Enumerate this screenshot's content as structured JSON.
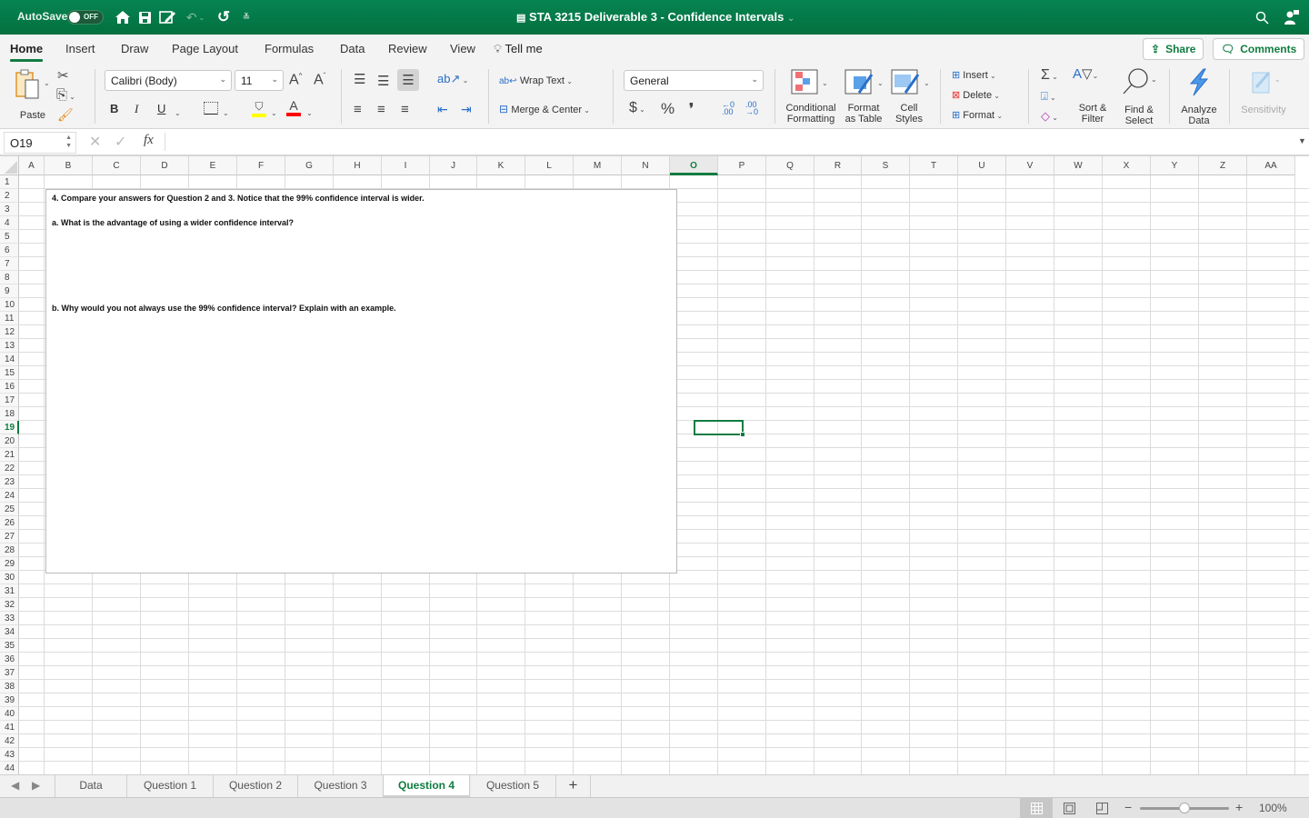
{
  "titlebar": {
    "autosave_label": "AutoSave",
    "autosave_state": "OFF",
    "doc_title": "STA 3215 Deliverable 3 - Confidence Intervals",
    "icons": [
      "home-icon",
      "save-icon",
      "edit-icon",
      "undo-icon",
      "redo-icon",
      "customize-icon",
      "search-icon",
      "account-icon"
    ]
  },
  "ribbon_tabs": [
    "Home",
    "Insert",
    "Draw",
    "Page Layout",
    "Formulas",
    "Data",
    "Review",
    "View"
  ],
  "active_tab": "Home",
  "tell_me": "Tell me",
  "share_label": "Share",
  "comments_label": "Comments",
  "ribbon": {
    "paste": "Paste",
    "font_name": "Calibri (Body)",
    "font_size": "11",
    "bold": "B",
    "italic": "I",
    "underline": "U",
    "wrap_text": "Wrap Text",
    "merge_center": "Merge & Center",
    "number_format": "General",
    "currency": "$",
    "percent": "%",
    "comma": "❜",
    "conditional_formatting": [
      "Conditional",
      "Formatting"
    ],
    "format_as_table": [
      "Format",
      "as Table"
    ],
    "cell_styles": [
      "Cell",
      "Styles"
    ],
    "insert": "Insert",
    "delete": "Delete",
    "format": "Format",
    "sort_filter": [
      "Sort &",
      "Filter"
    ],
    "find_select": [
      "Find &",
      "Select"
    ],
    "analyze_data": [
      "Analyze",
      "Data"
    ],
    "sensitivity": "Sensitivity",
    "colors": {
      "highlight": "#ffff00",
      "font_color": "#ff0000",
      "accent": "#107c41"
    }
  },
  "formula_bar": {
    "name_box": "O19",
    "fx": "fx",
    "formula": ""
  },
  "grid": {
    "columns": [
      "A",
      "B",
      "C",
      "D",
      "E",
      "F",
      "G",
      "H",
      "I",
      "J",
      "K",
      "L",
      "M",
      "N",
      "O",
      "P",
      "Q",
      "R",
      "S",
      "T",
      "U",
      "V",
      "W",
      "X",
      "Y",
      "Z",
      "AA"
    ],
    "selected_column": "O",
    "rows": [
      "1",
      "2",
      "3",
      "4",
      "5",
      "6",
      "7",
      "8",
      "9",
      "10",
      "11",
      "12",
      "13",
      "14",
      "15",
      "16",
      "17",
      "18",
      "19",
      "20",
      "21",
      "22",
      "23",
      "24",
      "25",
      "26",
      "27",
      "28",
      "29",
      "30",
      "31",
      "32",
      "33",
      "34",
      "35",
      "36",
      "37",
      "38",
      "39",
      "40",
      "41",
      "42",
      "43",
      "44"
    ],
    "selected_row": "19",
    "selected_cell": "O19"
  },
  "textbox": {
    "line1": "4. Compare your answers for Question 2 and 3.  Notice that the 99% confidence interval is wider.",
    "line2": "a. What is the advantage of using a wider confidence interval?",
    "line3": "b. Why would you not always use the 99% confidence interval? Explain with an example."
  },
  "sheet_tabs": [
    "Data",
    "Question 1",
    "Question 2",
    "Question 3",
    "Question 4",
    "Question 5"
  ],
  "active_sheet": "Question 4",
  "add_sheet": "+",
  "status": {
    "zoom": "100%",
    "zoom_fraction": 0.5
  }
}
